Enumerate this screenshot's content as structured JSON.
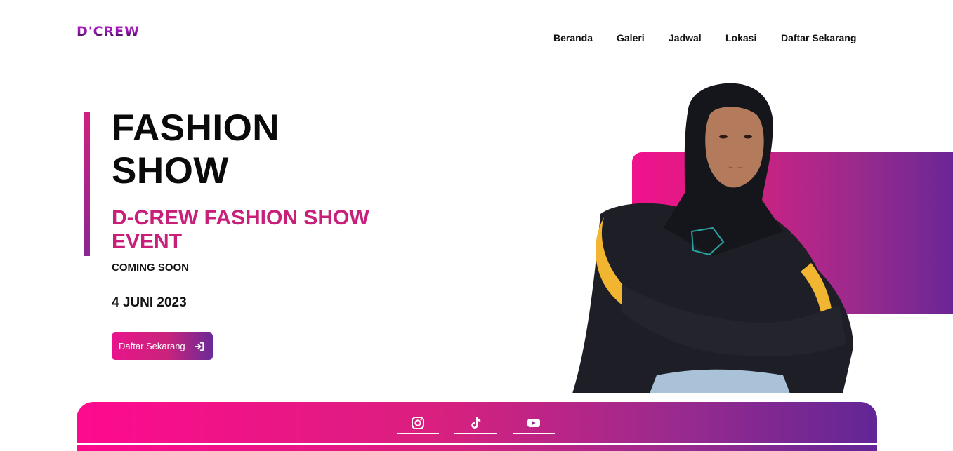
{
  "header": {
    "logo": "D'CREW",
    "nav": [
      "Beranda",
      "Galeri",
      "Jadwal",
      "Lokasi",
      "Daftar Sekarang"
    ]
  },
  "hero": {
    "title_line1": "FASHION",
    "title_line2": "SHOW",
    "subtitle_line1": "D-CREW FASHION SHOW",
    "subtitle_line2": "EVENT",
    "status": "COMING SOON",
    "date": "4 JUNI 2023",
    "cta_label": "Daftar Sekarang"
  },
  "social": {
    "icons": [
      "instagram-icon",
      "tiktok-icon",
      "youtube-icon"
    ]
  },
  "colors": {
    "accent_pink": "#e8148b",
    "accent_purple": "#6b2a98",
    "subtitle": "#c8207a"
  }
}
